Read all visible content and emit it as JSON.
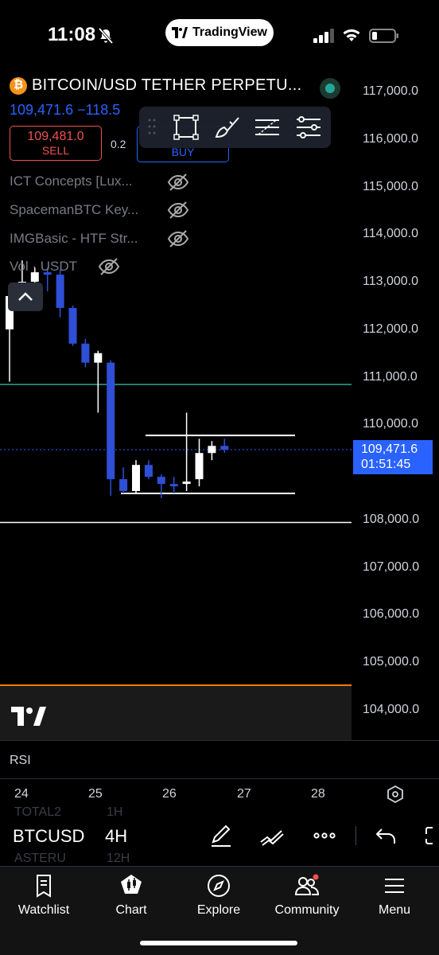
{
  "status_bar": {
    "time": "11:08",
    "app_badge": "TradingView"
  },
  "symbol": {
    "title": "BITCOIN/USD TETHER PERPETU...",
    "price_change": "109,471.6  −118.5"
  },
  "trade": {
    "sell_price": "109,481.0",
    "sell_label": "SELL",
    "spread": "0.2",
    "buy_label": "BUY"
  },
  "indicators": [
    {
      "name": "ICT Concepts [Lux..."
    },
    {
      "name": "SpacemanBTC Key..."
    },
    {
      "name": "IMGBasic - HTF Str..."
    },
    {
      "name": "Vol · USDT"
    }
  ],
  "price_axis": {
    "ticks": [
      "117,000.0",
      "116,000.0",
      "115,000.0",
      "114,000.0",
      "113,000.0",
      "112,000.0",
      "111,000.0",
      "110,000.0",
      "108,000.0",
      "107,000.0",
      "106,000.0",
      "105,000.0",
      "104,000.0"
    ],
    "last_price": "109,471.6",
    "countdown": "01:51:45"
  },
  "time_axis": {
    "ticks": [
      "24",
      "25",
      "26",
      "27",
      "28"
    ]
  },
  "rsi": {
    "label": "RSI"
  },
  "symbol_bar": {
    "symbol": "BTCUSD",
    "interval": "4H",
    "ghost_symbol_above": "TOTAL2",
    "ghost_interval_above": "1H",
    "ghost_symbol_below": "ASTERU",
    "ghost_interval_below": "12H"
  },
  "nav": [
    {
      "label": "Watchlist",
      "icon": "watchlist-icon"
    },
    {
      "label": "Chart",
      "icon": "chart-icon"
    },
    {
      "label": "Explore",
      "icon": "compass-icon"
    },
    {
      "label": "Community",
      "icon": "community-icon"
    },
    {
      "label": "Menu",
      "icon": "menu-icon"
    }
  ],
  "colors": {
    "up": "#ffffff",
    "down": "#2f4fd6",
    "accent": "#2962ff",
    "sell": "#ef5350",
    "line_green": "#26a69a",
    "divider": "#f57c00"
  },
  "chart_data": {
    "type": "candlestick",
    "y_range": [
      103800,
      117300
    ],
    "horizontal_lines": [
      {
        "price": 110840,
        "color": "#26a69a"
      },
      {
        "price": 107940,
        "color": "#ffffff"
      },
      {
        "price": 109471.6,
        "style": "dotted",
        "color": "#2962ff"
      }
    ],
    "range_box": {
      "top": 109770,
      "bottom": 108550
    },
    "candles": [
      {
        "o": 112000,
        "h": 112900,
        "l": 110900,
        "c": 112700
      },
      {
        "o": 112700,
        "h": 113450,
        "l": 112500,
        "c": 113000
      },
      {
        "o": 113000,
        "h": 113300,
        "l": 112650,
        "c": 113200
      },
      {
        "o": 113200,
        "h": 113300,
        "l": 112800,
        "c": 113150
      },
      {
        "o": 113150,
        "h": 113250,
        "l": 112250,
        "c": 112450
      },
      {
        "o": 112450,
        "h": 112500,
        "l": 111650,
        "c": 111700
      },
      {
        "o": 111700,
        "h": 111800,
        "l": 111200,
        "c": 111300
      },
      {
        "o": 111300,
        "h": 111550,
        "l": 110250,
        "c": 111500
      },
      {
        "o": 111300,
        "h": 111350,
        "l": 108500,
        "c": 108850
      },
      {
        "o": 108850,
        "h": 109100,
        "l": 108550,
        "c": 108600
      },
      {
        "o": 108600,
        "h": 109250,
        "l": 108550,
        "c": 109150
      },
      {
        "o": 109150,
        "h": 109250,
        "l": 108850,
        "c": 108900
      },
      {
        "o": 108900,
        "h": 108950,
        "l": 108450,
        "c": 108750
      },
      {
        "o": 108750,
        "h": 108900,
        "l": 108550,
        "c": 108700
      },
      {
        "o": 108750,
        "h": 110250,
        "l": 108600,
        "c": 108800
      },
      {
        "o": 108850,
        "h": 109700,
        "l": 108700,
        "c": 109400
      },
      {
        "o": 109400,
        "h": 109650,
        "l": 109250,
        "c": 109550
      },
      {
        "o": 109550,
        "h": 109700,
        "l": 109400,
        "c": 109470
      }
    ]
  }
}
